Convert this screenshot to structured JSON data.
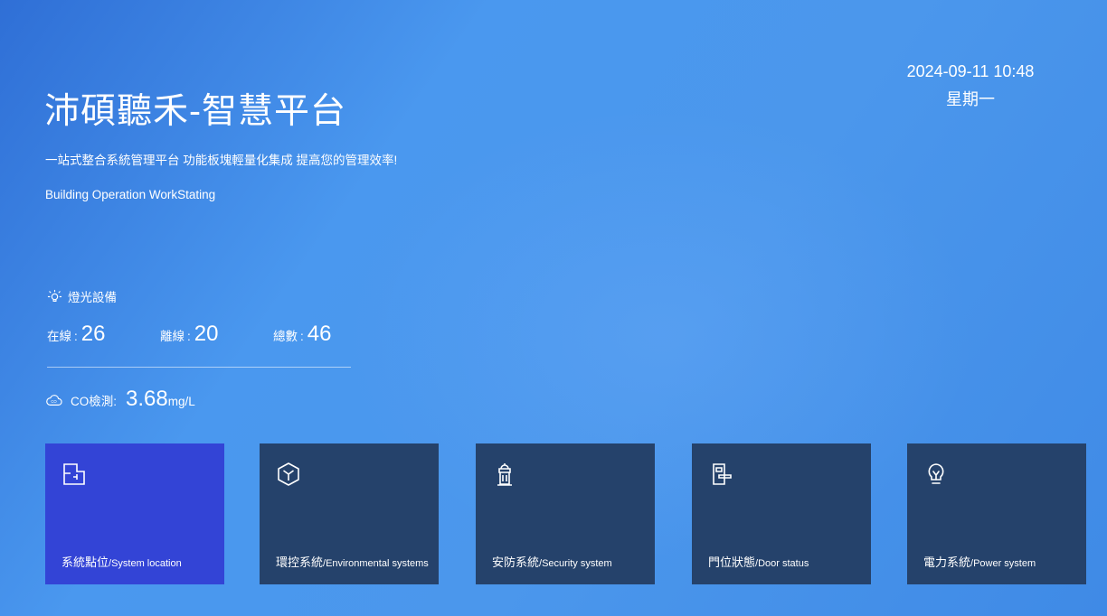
{
  "header": {
    "title": "沛碩聽禾-智慧平台",
    "subtitle": "一站式整合系統管理平台 功能板塊輕量化集成 提高您的管理效率!",
    "english_name": "Building Operation WorkStating"
  },
  "datetime": {
    "date": "2024-09-11 10:48",
    "weekday": "星期一"
  },
  "lighting": {
    "title": "燈光設備",
    "icon": "lightbulb-icon",
    "online_label": "在線",
    "online_value": "26",
    "offline_label": "離線",
    "offline_value": "20",
    "total_label": "總數",
    "total_value": "46",
    "colon": ":"
  },
  "co": {
    "icon": "cloud-co-icon",
    "label": "CO檢測:",
    "value": "3.68",
    "unit": "mg/L"
  },
  "cards": [
    {
      "zh": "系統點位",
      "en": "/System location",
      "icon": "floorplan-icon",
      "active": true
    },
    {
      "zh": "環控系統",
      "en": "/Environmental systems",
      "icon": "cube-icon",
      "active": false
    },
    {
      "zh": "安防系統",
      "en": "/Security system",
      "icon": "hydrant-icon",
      "active": false
    },
    {
      "zh": "門位狀態",
      "en": "/Door status",
      "icon": "door-lock-icon",
      "active": false
    },
    {
      "zh": "電力系統",
      "en": "/Power system",
      "icon": "bulb-icon",
      "active": false
    }
  ],
  "colors": {
    "active_card": "#3344d6",
    "card": "#25426b",
    "background": "#4a98ef"
  }
}
